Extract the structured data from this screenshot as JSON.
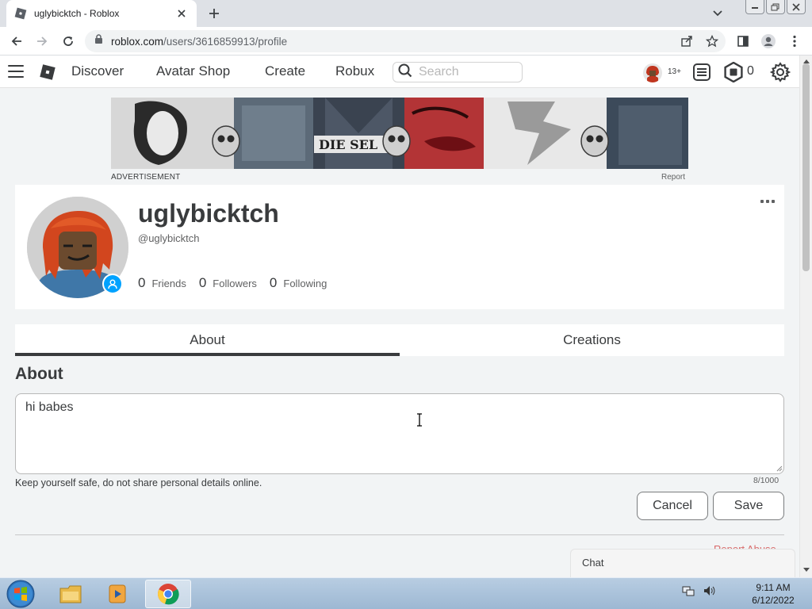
{
  "browser": {
    "tab_title": "uglybicktch - Roblox",
    "url_host": "roblox.com",
    "url_path": "/users/3616859913/profile"
  },
  "header": {
    "nav": [
      "Discover",
      "Avatar Shop",
      "Create",
      "Robux"
    ],
    "search_placeholder": "Search",
    "age_badge": "13+",
    "robux_balance": "0"
  },
  "ad": {
    "label": "ADVERTISEMENT",
    "report": "Report",
    "banner_text": "DIE SEL"
  },
  "profile": {
    "display_name": "uglybicktch",
    "username": "@uglybicktch",
    "stats": [
      {
        "count": "0",
        "label": "Friends"
      },
      {
        "count": "0",
        "label": "Followers"
      },
      {
        "count": "0",
        "label": "Following"
      }
    ]
  },
  "tabs": [
    "About",
    "Creations"
  ],
  "about": {
    "heading": "About",
    "text": "hi babes",
    "safety_note": "Keep yourself safe, do not share personal details online.",
    "char_count": "8/1000",
    "cancel_label": "Cancel",
    "save_label": "Save",
    "report_abuse": "Report Abuse"
  },
  "chat": {
    "label": "Chat"
  },
  "taskbar": {
    "time": "9:11 AM",
    "date": "6/12/2022"
  },
  "colors": {
    "accent_blue": "#00a2ff",
    "text": "#393b3d",
    "report_red": "#d86868"
  }
}
